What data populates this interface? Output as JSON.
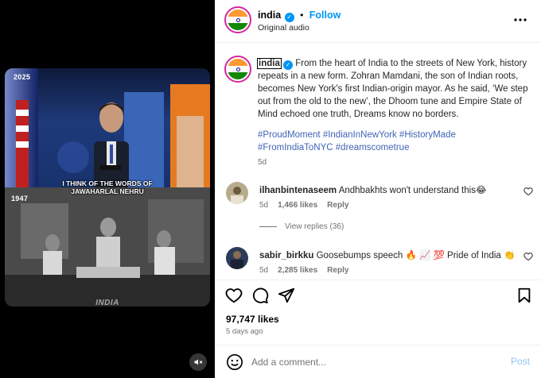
{
  "media": {
    "top_year": "2025",
    "bottom_year": "1947",
    "caption_line1": "I THINK OF THE WORDS OF",
    "caption_line2": "JAWAHARLAL NEHRU",
    "watermark": "INDIA",
    "mute_icon": "speaker-muted-icon"
  },
  "header": {
    "username": "india",
    "separator": "•",
    "follow_label": "Follow",
    "audio_label": "Original audio",
    "more_icon": "more-horizontal-icon"
  },
  "caption": {
    "username": "india",
    "text": "From the heart of India to the streets of New York, history repeats in a new form. Zohran Mamdani, the son of Indian roots, becomes New York's first Indian-origin mayor. As he said, ‘We step out from the old to the new’, the Dhoom tune and Empire State of Mind echoed one truth, Dreams know no borders.",
    "hashtags_line1": "#ProudMoment #IndianInNewYork #HistoryMade",
    "hashtags_line2": "#FromIndiaToNYC #dreamscometrue",
    "age": "5d"
  },
  "comments": [
    {
      "username": "ilhanbintenaseem",
      "text": "Andhbakhts won't understand this",
      "emoji": "😂",
      "age": "5d",
      "likes": "1,466 likes",
      "reply_label": "Reply"
    },
    {
      "username": "sabir_birkku",
      "text": "Goosebumps speech 🔥 📈 💯  Pride of India 👏",
      "age": "5d",
      "likes": "2,285 likes",
      "reply_label": "Reply"
    }
  ],
  "view_replies_label": "View replies (36)",
  "actions": {
    "like_icon": "heart-icon",
    "comment_icon": "comment-bubble-icon",
    "share_icon": "paper-plane-icon",
    "save_icon": "bookmark-icon",
    "likes_count": "97,747 likes",
    "posted_ago": "5 days ago"
  },
  "composer": {
    "placeholder": "Add a comment...",
    "post_label": "Post",
    "emoji_icon": "smiley-icon"
  },
  "colors": {
    "accent": "#0095f6",
    "hashtag": "#3f64b5",
    "muted": "#737373",
    "post_disabled": "#90c3f5"
  }
}
